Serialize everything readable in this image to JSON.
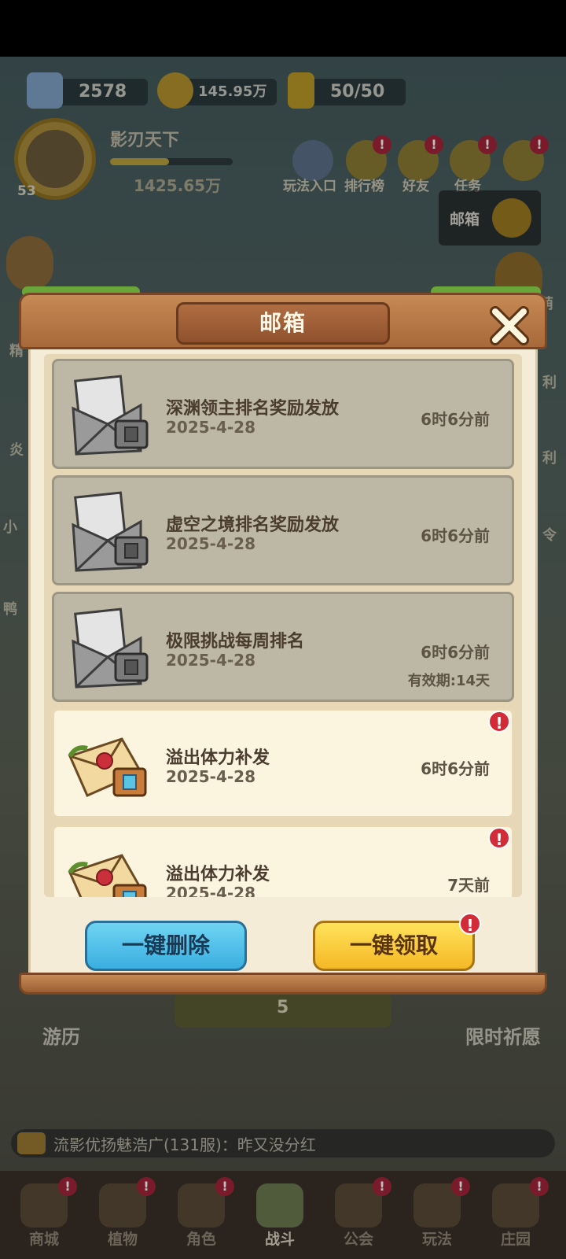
{
  "resources": [
    {
      "icon": "diamond-icon",
      "value": "2578"
    },
    {
      "icon": "gold-coin-icon",
      "value": "145.95万"
    },
    {
      "icon": "energy-icon",
      "value": "50/50"
    }
  ],
  "player": {
    "name": "影刃天下",
    "level": "53",
    "power": "1425.65万",
    "exp_fraction": 0.48
  },
  "top_icons": [
    {
      "label": "玩法入口",
      "icon": "gamepad-icon",
      "badge": false
    },
    {
      "label": "排行榜",
      "icon": "rank-icon",
      "badge": true
    },
    {
      "label": "好友",
      "icon": "friends-icon",
      "badge": true
    },
    {
      "label": "任务",
      "icon": "task-icon",
      "badge": true
    }
  ],
  "mail_shortcut": {
    "label": "邮箱",
    "icon": "mail-icon"
  },
  "side_labels_left": [
    "精",
    "炎",
    "小",
    "鸭"
  ],
  "side_labels_right": [
    "萌",
    "利",
    "利",
    "令"
  ],
  "bottom_left_label": "游历",
  "bottom_center_value": "5",
  "bottom_right_label": "限时祈愿",
  "chat": {
    "text": "流影优扬魅浩广(131服)：昨又没分红",
    "icon": "chat-icon"
  },
  "bottom_nav": [
    {
      "label": "商城",
      "icon": "shop-icon",
      "badge": true,
      "active": false
    },
    {
      "label": "植物",
      "icon": "plant-icon",
      "badge": true,
      "active": false
    },
    {
      "label": "角色",
      "icon": "character-icon",
      "badge": true,
      "active": false
    },
    {
      "label": "战斗",
      "icon": "battle-icon",
      "badge": false,
      "active": true
    },
    {
      "label": "公会",
      "icon": "guild-icon",
      "badge": true,
      "active": false
    },
    {
      "label": "玩法",
      "icon": "gameplay-icon",
      "badge": true,
      "active": false
    },
    {
      "label": "庄园",
      "icon": "manor-icon",
      "badge": true,
      "active": false
    }
  ],
  "modal": {
    "title": "邮箱",
    "close_icon": "close-icon",
    "mails": [
      {
        "title": "深渊领主排名奖励发放",
        "date": "2025-4-28",
        "time": "6时6分前",
        "expiry": "",
        "state": "read",
        "badge": false
      },
      {
        "title": "虚空之境排名奖励发放",
        "date": "2025-4-28",
        "time": "6时6分前",
        "expiry": "",
        "state": "read",
        "badge": false
      },
      {
        "title": "极限挑战每周排名",
        "date": "2025-4-28",
        "time": "6时6分前",
        "expiry": "有效期:14天",
        "state": "read",
        "badge": false
      },
      {
        "title": "溢出体力补发",
        "date": "2025-4-28",
        "time": "6时6分前",
        "expiry": "",
        "state": "unread",
        "badge": true
      },
      {
        "title": "溢出体力补发",
        "date": "2025-4-28",
        "time": "7天前",
        "expiry": "",
        "state": "unread",
        "badge": true
      }
    ],
    "delete_all_label": "一键删除",
    "claim_all_label": "一键领取",
    "badge_symbol": "!"
  },
  "colors": {
    "accent_blue": "#3aaee0",
    "accent_yellow": "#f4b826",
    "badge_red": "#d22c39",
    "wood": "#a8693a"
  }
}
